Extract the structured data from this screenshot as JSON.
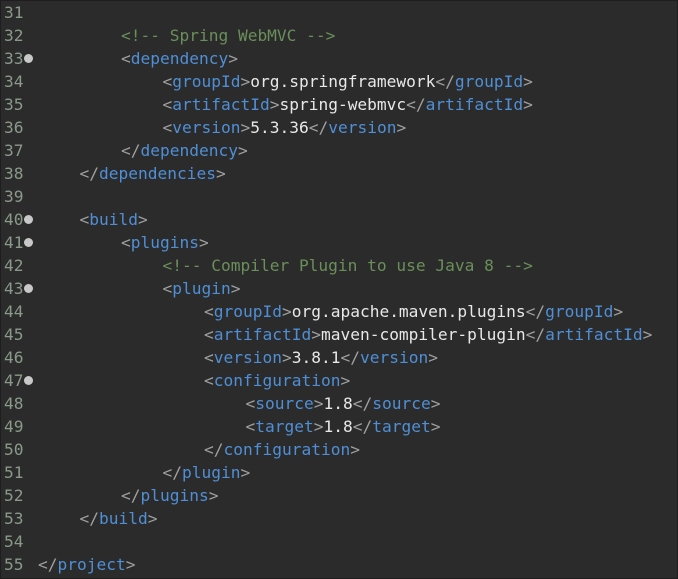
{
  "editor": {
    "lines": [
      {
        "n": "31",
        "fold": false,
        "indent": 0,
        "segs": []
      },
      {
        "n": "32",
        "fold": false,
        "indent": 2,
        "segs": [
          {
            "t": "<!-- Spring WebMVC -->",
            "c": "cm"
          }
        ]
      },
      {
        "n": "33",
        "fold": true,
        "indent": 2,
        "segs": [
          {
            "t": "<",
            "c": "bk"
          },
          {
            "t": "dependency",
            "c": "tag"
          },
          {
            "t": ">",
            "c": "bk"
          }
        ]
      },
      {
        "n": "34",
        "fold": false,
        "indent": 3,
        "segs": [
          {
            "t": "<",
            "c": "bk"
          },
          {
            "t": "groupId",
            "c": "tag"
          },
          {
            "t": ">",
            "c": "bk"
          },
          {
            "t": "org.springframework",
            "c": "tx"
          },
          {
            "t": "</",
            "c": "bk"
          },
          {
            "t": "groupId",
            "c": "tag"
          },
          {
            "t": ">",
            "c": "bk"
          }
        ]
      },
      {
        "n": "35",
        "fold": false,
        "indent": 3,
        "segs": [
          {
            "t": "<",
            "c": "bk"
          },
          {
            "t": "artifactId",
            "c": "tag"
          },
          {
            "t": ">",
            "c": "bk"
          },
          {
            "t": "spring-webmvc",
            "c": "tx"
          },
          {
            "t": "</",
            "c": "bk"
          },
          {
            "t": "artifactId",
            "c": "tag"
          },
          {
            "t": ">",
            "c": "bk"
          }
        ]
      },
      {
        "n": "36",
        "fold": false,
        "indent": 3,
        "segs": [
          {
            "t": "<",
            "c": "bk"
          },
          {
            "t": "version",
            "c": "tag"
          },
          {
            "t": ">",
            "c": "bk"
          },
          {
            "t": "5.3.36",
            "c": "tx"
          },
          {
            "t": "</",
            "c": "bk"
          },
          {
            "t": "version",
            "c": "tag"
          },
          {
            "t": ">",
            "c": "bk"
          }
        ]
      },
      {
        "n": "37",
        "fold": false,
        "indent": 2,
        "segs": [
          {
            "t": "</",
            "c": "bk"
          },
          {
            "t": "dependency",
            "c": "tag"
          },
          {
            "t": ">",
            "c": "bk"
          }
        ]
      },
      {
        "n": "38",
        "fold": false,
        "indent": 1,
        "segs": [
          {
            "t": "</",
            "c": "bk"
          },
          {
            "t": "dependencies",
            "c": "tag"
          },
          {
            "t": ">",
            "c": "bk"
          }
        ]
      },
      {
        "n": "39",
        "fold": false,
        "indent": 0,
        "segs": []
      },
      {
        "n": "40",
        "fold": true,
        "indent": 1,
        "segs": [
          {
            "t": "<",
            "c": "bk"
          },
          {
            "t": "build",
            "c": "tag"
          },
          {
            "t": ">",
            "c": "bk"
          }
        ]
      },
      {
        "n": "41",
        "fold": true,
        "indent": 2,
        "segs": [
          {
            "t": "<",
            "c": "bk"
          },
          {
            "t": "plugins",
            "c": "tag"
          },
          {
            "t": ">",
            "c": "bk"
          }
        ]
      },
      {
        "n": "42",
        "fold": false,
        "indent": 3,
        "segs": [
          {
            "t": "<!-- Compiler Plugin to use Java 8 -->",
            "c": "cm"
          }
        ]
      },
      {
        "n": "43",
        "fold": true,
        "indent": 3,
        "segs": [
          {
            "t": "<",
            "c": "bk"
          },
          {
            "t": "plugin",
            "c": "tag"
          },
          {
            "t": ">",
            "c": "bk"
          }
        ]
      },
      {
        "n": "44",
        "fold": false,
        "indent": 4,
        "segs": [
          {
            "t": "<",
            "c": "bk"
          },
          {
            "t": "groupId",
            "c": "tag"
          },
          {
            "t": ">",
            "c": "bk"
          },
          {
            "t": "org.apache.maven.plugins",
            "c": "tx"
          },
          {
            "t": "</",
            "c": "bk"
          },
          {
            "t": "groupId",
            "c": "tag"
          },
          {
            "t": ">",
            "c": "bk"
          }
        ]
      },
      {
        "n": "45",
        "fold": false,
        "indent": 4,
        "segs": [
          {
            "t": "<",
            "c": "bk"
          },
          {
            "t": "artifactId",
            "c": "tag"
          },
          {
            "t": ">",
            "c": "bk"
          },
          {
            "t": "maven-compiler-plugin",
            "c": "tx"
          },
          {
            "t": "</",
            "c": "bk"
          },
          {
            "t": "artifactId",
            "c": "tag"
          },
          {
            "t": ">",
            "c": "bk"
          }
        ]
      },
      {
        "n": "46",
        "fold": false,
        "indent": 4,
        "segs": [
          {
            "t": "<",
            "c": "bk"
          },
          {
            "t": "version",
            "c": "tag"
          },
          {
            "t": ">",
            "c": "bk"
          },
          {
            "t": "3.8.1",
            "c": "tx"
          },
          {
            "t": "</",
            "c": "bk"
          },
          {
            "t": "version",
            "c": "tag"
          },
          {
            "t": ">",
            "c": "bk"
          }
        ]
      },
      {
        "n": "47",
        "fold": true,
        "indent": 4,
        "segs": [
          {
            "t": "<",
            "c": "bk"
          },
          {
            "t": "configuration",
            "c": "tag"
          },
          {
            "t": ">",
            "c": "bk"
          }
        ]
      },
      {
        "n": "48",
        "fold": false,
        "indent": 5,
        "segs": [
          {
            "t": "<",
            "c": "bk"
          },
          {
            "t": "source",
            "c": "tag"
          },
          {
            "t": ">",
            "c": "bk"
          },
          {
            "t": "1.8",
            "c": "tx"
          },
          {
            "t": "</",
            "c": "bk"
          },
          {
            "t": "source",
            "c": "tag"
          },
          {
            "t": ">",
            "c": "bk"
          }
        ]
      },
      {
        "n": "49",
        "fold": false,
        "indent": 5,
        "segs": [
          {
            "t": "<",
            "c": "bk"
          },
          {
            "t": "target",
            "c": "tag"
          },
          {
            "t": ">",
            "c": "bk"
          },
          {
            "t": "1.8",
            "c": "tx"
          },
          {
            "t": "</",
            "c": "bk"
          },
          {
            "t": "target",
            "c": "tag"
          },
          {
            "t": ">",
            "c": "bk"
          }
        ]
      },
      {
        "n": "50",
        "fold": false,
        "indent": 4,
        "segs": [
          {
            "t": "</",
            "c": "bk"
          },
          {
            "t": "configuration",
            "c": "tag"
          },
          {
            "t": ">",
            "c": "bk"
          }
        ]
      },
      {
        "n": "51",
        "fold": false,
        "indent": 3,
        "segs": [
          {
            "t": "</",
            "c": "bk"
          },
          {
            "t": "plugin",
            "c": "tag"
          },
          {
            "t": ">",
            "c": "bk"
          }
        ]
      },
      {
        "n": "52",
        "fold": false,
        "indent": 2,
        "segs": [
          {
            "t": "</",
            "c": "bk"
          },
          {
            "t": "plugins",
            "c": "tag"
          },
          {
            "t": ">",
            "c": "bk"
          }
        ]
      },
      {
        "n": "53",
        "fold": false,
        "indent": 1,
        "segs": [
          {
            "t": "</",
            "c": "bk"
          },
          {
            "t": "build",
            "c": "tag"
          },
          {
            "t": ">",
            "c": "bk"
          }
        ]
      },
      {
        "n": "54",
        "fold": false,
        "indent": 0,
        "segs": []
      },
      {
        "n": "55",
        "fold": false,
        "indent": 0,
        "segs": [
          {
            "t": "</",
            "c": "bk"
          },
          {
            "t": "project",
            "c": "tag"
          },
          {
            "t": ">",
            "c": "bk"
          }
        ]
      }
    ]
  }
}
